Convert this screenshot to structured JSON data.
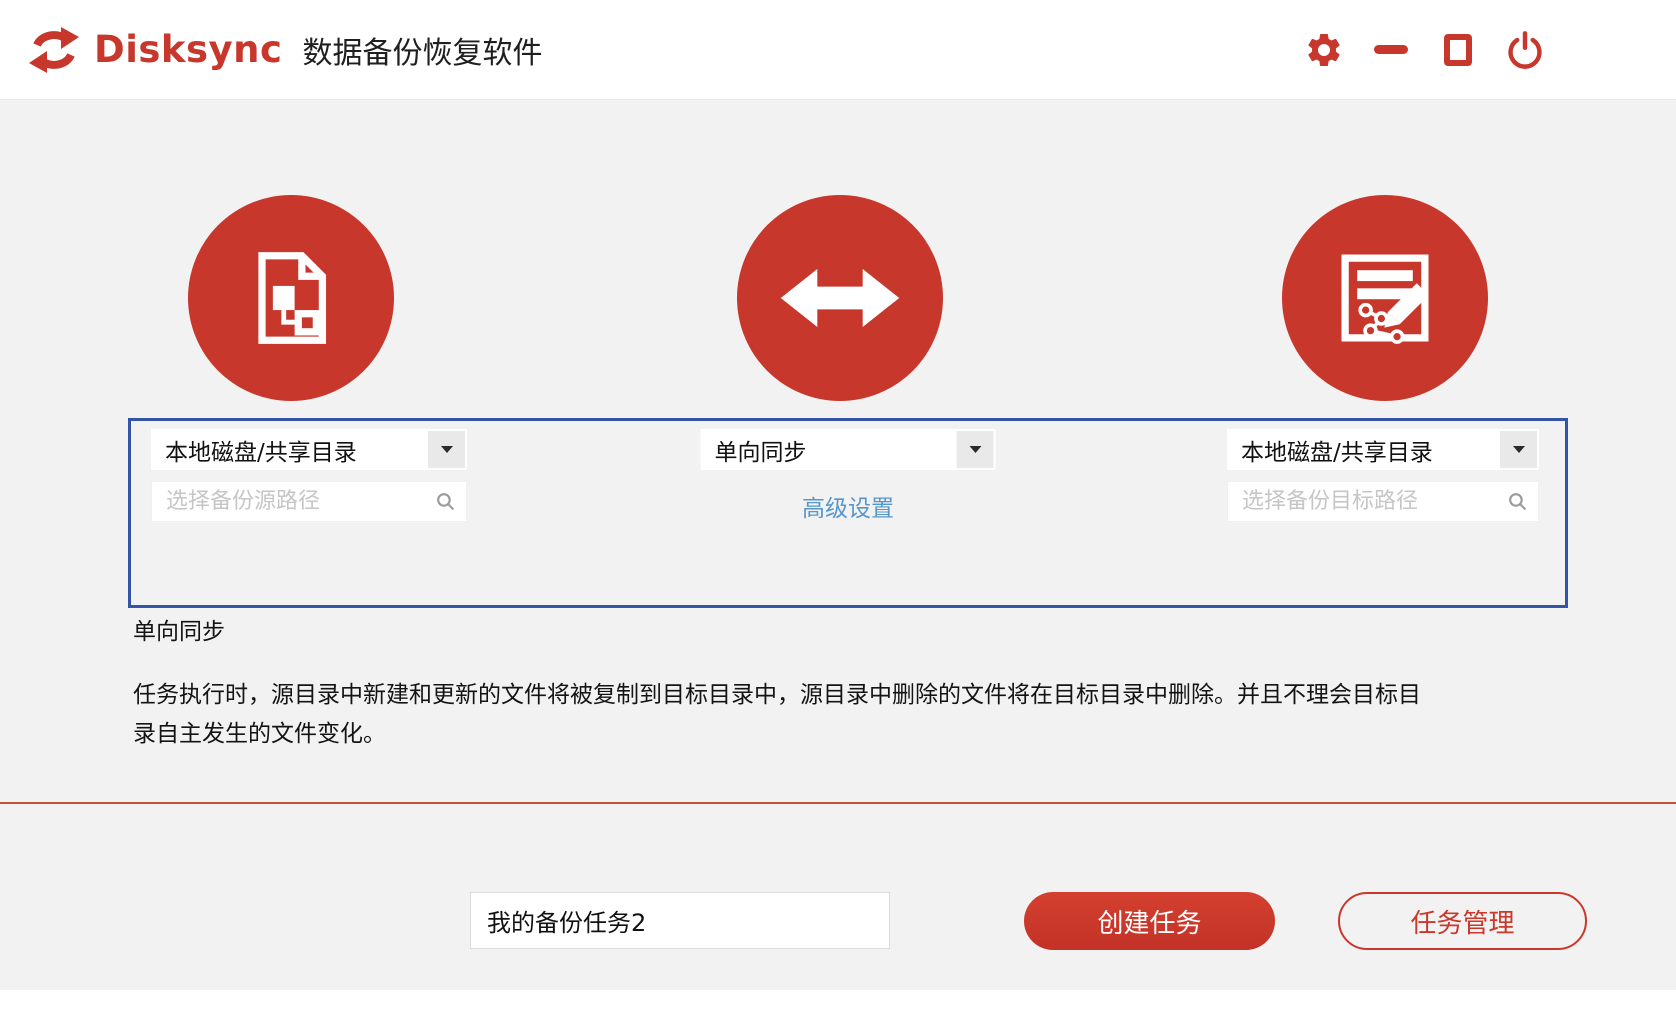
{
  "header": {
    "brand": "Disksync",
    "title": "数据备份恢复软件"
  },
  "icons": {
    "logo": "sync-circular-arrows",
    "settings": "gear",
    "minimize": "minus-bar",
    "maximize": "square-outline",
    "power": "power-symbol",
    "source_circle": "document-flowchart",
    "direction_circle": "double-headed-arrow",
    "target_circle": "document-pencil-edit",
    "path_search": "magnifier",
    "dropdown_caret": "caret-down"
  },
  "colors": {
    "brand_red": "#c8372b",
    "panel_border_blue": "#3454a8",
    "link_blue": "#5597cd",
    "divider_red": "#c25140",
    "background": "#f2f2f2"
  },
  "panel": {
    "source_type": "本地磁盘/共享目录",
    "source_path_placeholder": "选择备份源路径",
    "sync_mode": "单向同步",
    "advanced_settings": "高级设置",
    "target_type": "本地磁盘/共享目录",
    "target_path_placeholder": "选择备份目标路径"
  },
  "description": {
    "title": "单向同步",
    "body": "任务执行时，源目录中新建和更新的文件将被复制到目标目录中，源目录中删除的文件将在目标目录中删除。并且不理会目标目录自主发生的文件变化。"
  },
  "actions": {
    "task_name": "我的备份任务2",
    "create_task": "创建任务",
    "task_manager": "任务管理"
  }
}
